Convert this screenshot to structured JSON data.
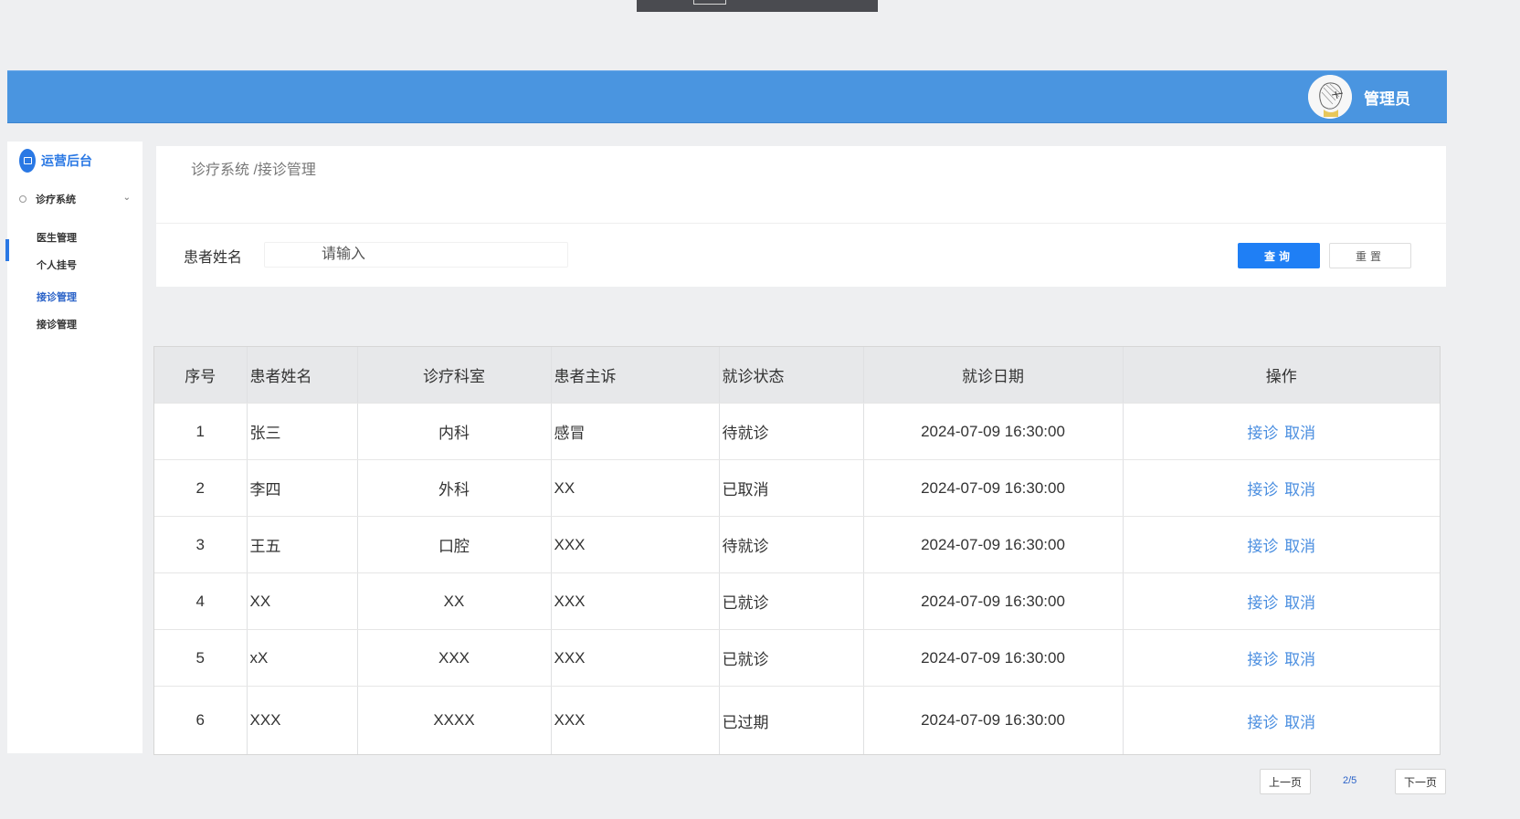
{
  "header": {
    "user_name": "管理员"
  },
  "sidebar": {
    "brand": "运营后台",
    "group": "诊疗系统",
    "items": [
      {
        "label": "医生管理"
      },
      {
        "label": "个人挂号"
      },
      {
        "label": "接诊管理"
      },
      {
        "label": "接诊管理"
      }
    ]
  },
  "breadcrumb": "诊疗系统 /接诊管理",
  "search": {
    "label": "患者姓名",
    "placeholder": "请输入",
    "query_button": "查询",
    "reset_button": "重置"
  },
  "table": {
    "columns": [
      "序号",
      "患者姓名",
      "诊疗科室",
      "患者主诉",
      "就诊状态",
      "就诊日期",
      "操作"
    ],
    "rows": [
      {
        "no": "1",
        "name": "张三",
        "dept": "内科",
        "complaint": "感冒",
        "status": "待就诊",
        "date": "2024-07-09 16:30:00"
      },
      {
        "no": "2",
        "name": "李四",
        "dept": "外科",
        "complaint": "XX",
        "status": "已取消",
        "date": "2024-07-09 16:30:00"
      },
      {
        "no": "3",
        "name": "王五",
        "dept": "口腔",
        "complaint": "XXX",
        "status": "待就诊",
        "date": "2024-07-09 16:30:00"
      },
      {
        "no": "4",
        "name": "XX",
        "dept": "XX",
        "complaint": "XXX",
        "status": "已就诊",
        "date": "2024-07-09 16:30:00"
      },
      {
        "no": "5",
        "name": "xX",
        "dept": "XXX",
        "complaint": "XXX",
        "status": "已就诊",
        "date": "2024-07-09 16:30:00"
      },
      {
        "no": "6",
        "name": "XXX",
        "dept": "XXXX",
        "complaint": "XXX",
        "status": "已过期",
        "date": "2024-07-09 16:30:00"
      }
    ],
    "action_accept": "接诊",
    "action_cancel": "取消"
  },
  "pagination": {
    "prev": "上一页",
    "info": "2/5",
    "next": "下一页"
  },
  "colors": {
    "header": "#4a95e0",
    "primary": "#1f7ff5",
    "link": "#4a8ee0",
    "accent": "#2a78e4"
  }
}
